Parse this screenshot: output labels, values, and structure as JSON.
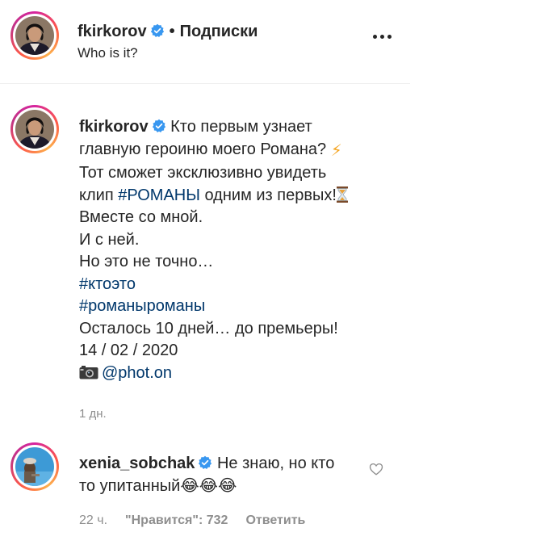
{
  "header": {
    "username": "fkirkorov",
    "separator": "•",
    "follow_label": "Подписки",
    "location": "Who is it?"
  },
  "caption": {
    "username": "fkirkorov",
    "line1": "Кто первым узнает",
    "line2": "главную героиню моего Романа?",
    "line3": "Тот сможет эксклюзивно увидеть",
    "line4_pre": "клип ",
    "line4_tag": "#РОМАНЫ",
    "line4_post": " одним из первых!",
    "line5": "Вместе со мной.",
    "line6": "И с ней.",
    "line7": "Но это не точно…",
    "tag1": "#ктоэто",
    "tag2": "#романыроманы",
    "line10": "Осталось 10 дней… до премьеры!",
    "line11": "14 / 02 / 2020",
    "mention": "@phot.on",
    "time": "1 дн."
  },
  "comment": {
    "username": "xenia_sobchak",
    "text_part1": "Не знаю, но кто",
    "text_part2": "то упитанный",
    "emoji": "😂😂😂",
    "time": "22 ч.",
    "likes": "\"Нравится\": 732",
    "reply_label": "Ответить"
  },
  "icons": {
    "verified": "verified-badge-icon",
    "more": "more-options-icon",
    "bolt": "high-voltage-emoji",
    "hourglass": "hourglass-emoji",
    "camera": "camera-emoji",
    "heart": "heart-outline-icon"
  },
  "colors": {
    "verified": "#3897f0",
    "hashtag": "#00376b",
    "secondary_text": "#8e8e8e"
  }
}
